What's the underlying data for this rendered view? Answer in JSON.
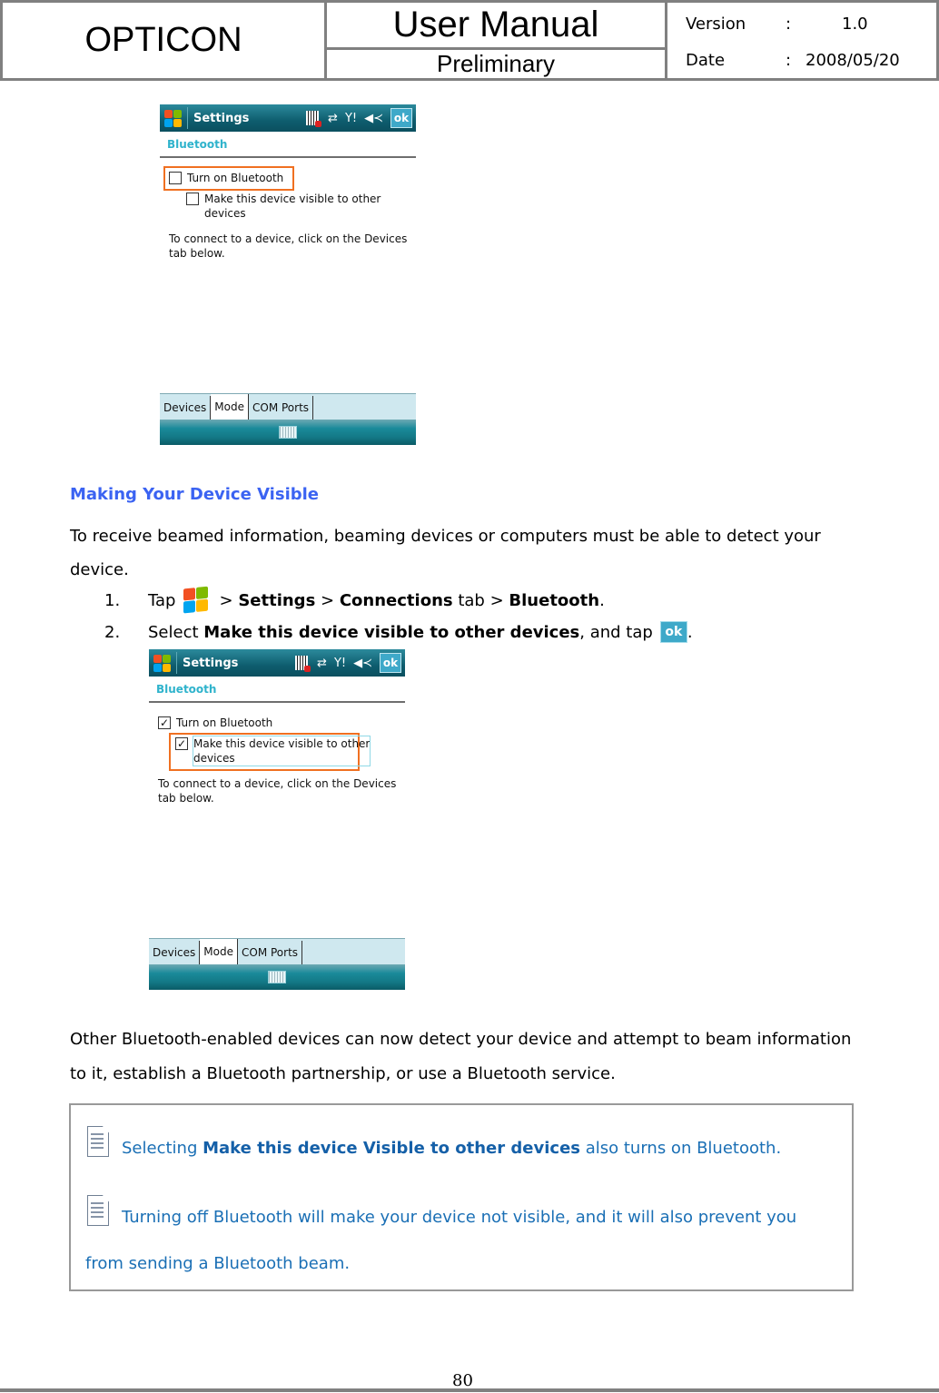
{
  "header": {
    "brand": "OPTICON",
    "title": "User Manual",
    "subtitle": "Preliminary",
    "version_label": "Version",
    "version_colon": ":",
    "version_value": "1.0",
    "date_label": "Date",
    "date_colon": ":",
    "date_value": "2008/05/20"
  },
  "screenshot1": {
    "app_title": "Settings",
    "ok_label": "ok",
    "page_title": "Bluetooth",
    "options": [
      {
        "label": "Turn on Bluetooth",
        "checked": false,
        "highlighted": true
      },
      {
        "label": "Make this device visible to other devices",
        "checked": false,
        "highlighted": false
      }
    ],
    "option1_line1": "Make this device visible to other",
    "option1_line2": "devices",
    "hint": "To connect to a device, click on the Devices tab below.",
    "tabs": [
      "Devices",
      "Mode",
      "COM Ports"
    ],
    "active_tab": "Mode"
  },
  "screenshot2": {
    "app_title": "Settings",
    "ok_label": "ok",
    "page_title": "Bluetooth",
    "options": [
      {
        "label": "Turn on Bluetooth",
        "checked": true,
        "highlighted": false
      },
      {
        "label": "Make this device visible to other devices",
        "checked": true,
        "highlighted": true
      }
    ],
    "option1_line1": "Make this device visible to other",
    "option1_line2": "devices",
    "hint": "To connect to a device, click on the Devices tab below.",
    "tabs": [
      "Devices",
      "Mode",
      "COM Ports"
    ],
    "active_tab": "Mode"
  },
  "section": {
    "heading": "Making Your Device Visible",
    "intro": "To receive beamed information, beaming devices or computers must be able to detect your device.",
    "steps": [
      {
        "num": "1.",
        "pre": "Tap",
        "icon": "windows-start-icon",
        "sep1": ">",
        "b1": "Settings",
        "sep2": ">",
        "b2": "Connections",
        "mid": "tab >",
        "b3": "Bluetooth",
        "end": "."
      },
      {
        "num": "2.",
        "pre": "Select",
        "b1": "Make this device visible to other devices",
        "mid": ", and tap",
        "icon": "ok-button-icon",
        "icon_label": "ok",
        "end": "."
      }
    ],
    "outro": "Other Bluetooth-enabled devices can now detect your device and attempt to beam information to it, establish a Bluetooth partnership, or use a Bluetooth service."
  },
  "notes": [
    {
      "icon": "note-icon",
      "pre": "Selecting",
      "bold": "Make this device Visible to other devices",
      "post": "also turns on Bluetooth."
    },
    {
      "icon": "note-icon",
      "line1": "Turning off Bluetooth will make your device not visible, and it will also prevent you",
      "line2": "from sending a Bluetooth beam."
    }
  ],
  "footer": {
    "page_number": "80"
  },
  "colors": {
    "heading_blue": "#3b63f2",
    "note_blue": "#1a6fb5",
    "highlight_orange": "#f07021",
    "ppc_teal": "#0e5d6e"
  }
}
